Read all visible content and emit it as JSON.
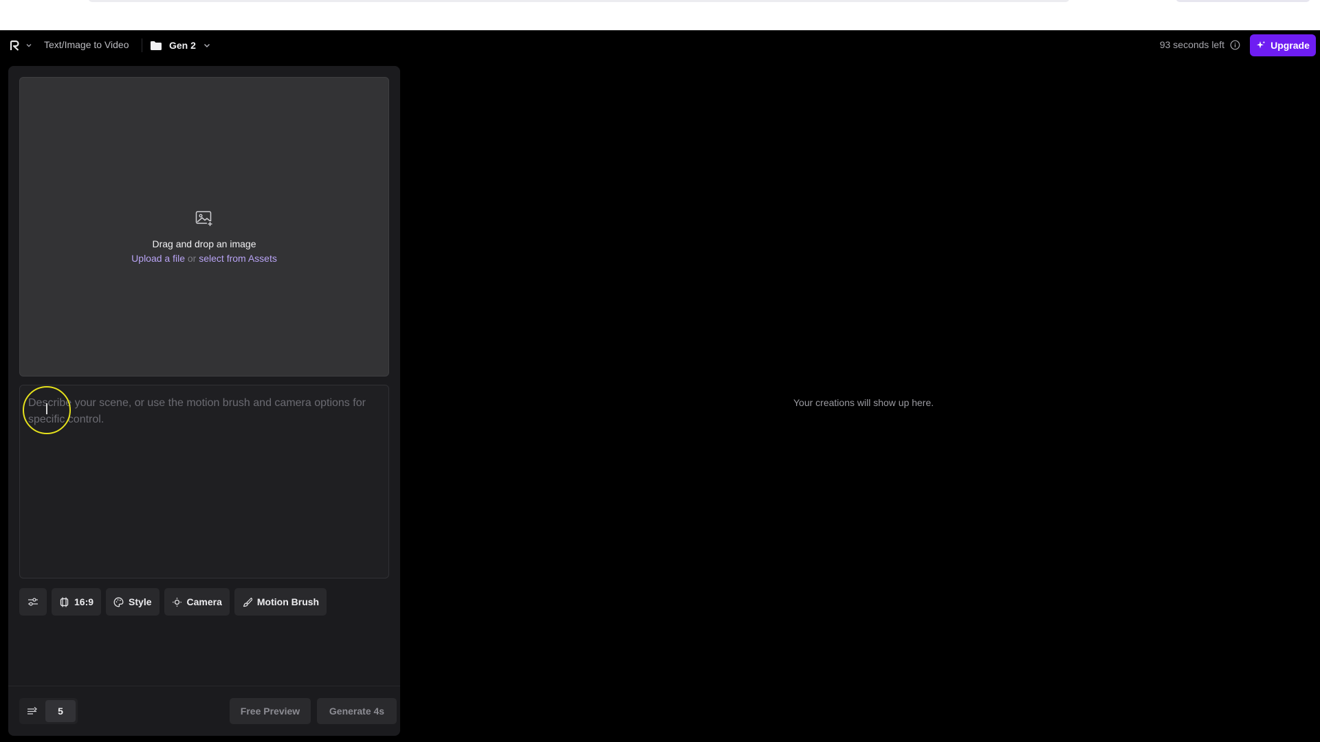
{
  "header": {
    "logo_icon": "runway-logo-icon",
    "breadcrumb": "Text/Image to Video",
    "project_name": "Gen 2",
    "credits_text": "93 seconds left",
    "upgrade_label": "Upgrade",
    "accent_color": "#6e1df2"
  },
  "upload": {
    "icon": "image-add-icon",
    "title": "Drag and drop an image",
    "upload_link": "Upload a file",
    "or_text": "or",
    "assets_link": "select from Assets"
  },
  "prompt": {
    "placeholder": "Describe your scene, or use the motion brush and camera options for specific control.",
    "value": ""
  },
  "toolbar": {
    "settings_icon": "sliders-icon",
    "aspect_label": "16:9",
    "style_label": "Style",
    "camera_label": "Camera",
    "motion_brush_label": "Motion Brush"
  },
  "footer": {
    "count_icon": "batch-icon",
    "count_value": "5",
    "free_preview_label": "Free Preview",
    "generate_label": "Generate 4s"
  },
  "main": {
    "empty_message": "Your creations will show up here."
  }
}
